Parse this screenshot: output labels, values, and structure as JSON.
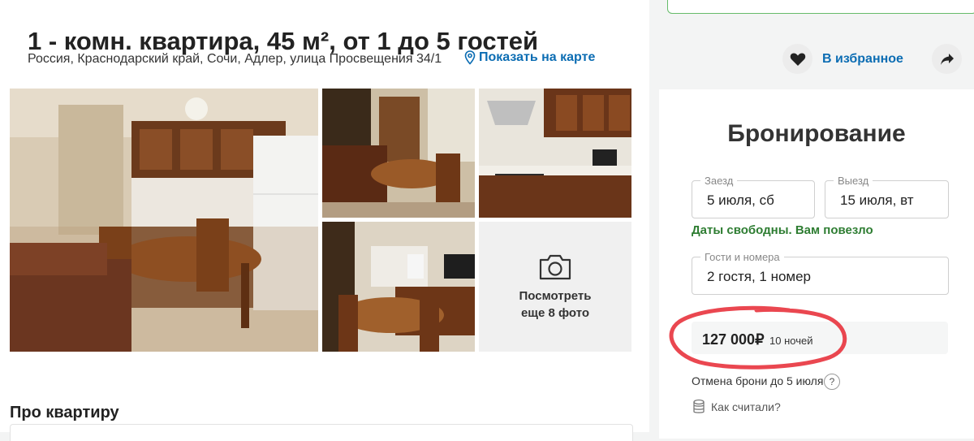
{
  "listing": {
    "title": "1 - комн. квартира, 45 м², от 1 до 5 гостей",
    "address": "Россия, Краснодарский край, Сочи, Адлер, улица Просвещения 34/1",
    "map_link": "Показать на карте",
    "favorite_label": "В избранное",
    "more_photos": "Посмотреть еще 8 фото",
    "about_title": "Про квартиру"
  },
  "booking": {
    "title": "Бронирование",
    "checkin_label": "Заезд",
    "checkin_value": "5 июля, сб",
    "checkout_label": "Выезд",
    "checkout_value": "15 июля, вт",
    "availability": "Даты свободны. Вам повезло",
    "guests_label": "Гости и номера",
    "guests_value": "2 гостя, 1 номер",
    "price": "127 000₽",
    "nights": "10 ночей",
    "cancellation": "Отмена брони до 5 июля",
    "how_calculated": "Как считали?"
  },
  "colors": {
    "link": "#0c6db3",
    "available": "#2e7d32",
    "highlight": "#e8333d"
  },
  "icons": [
    "map-pin-icon",
    "heart-icon",
    "share-icon",
    "camera-icon",
    "question-icon",
    "coins-icon"
  ]
}
